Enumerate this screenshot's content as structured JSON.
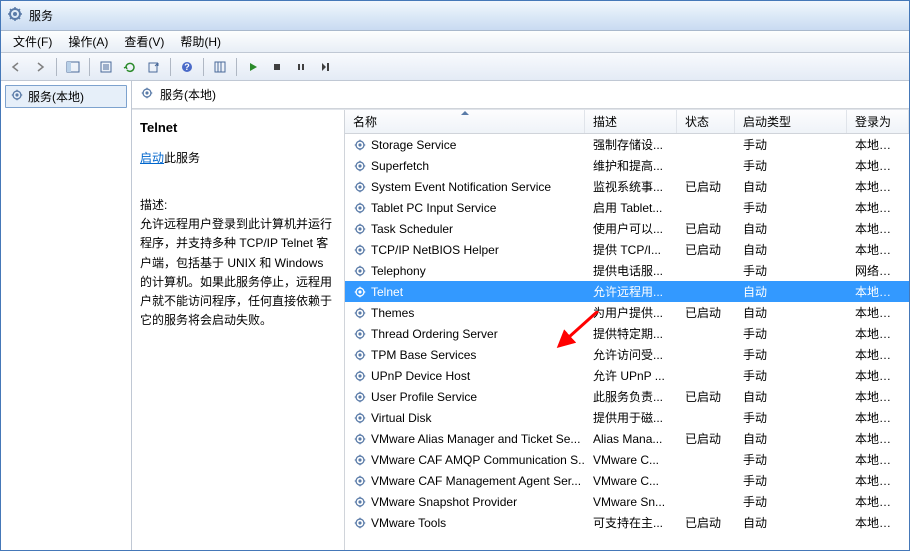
{
  "window": {
    "title": "服务"
  },
  "menu": {
    "file": "文件(F)",
    "action": "操作(A)",
    "view": "查看(V)",
    "help": "帮助(H)"
  },
  "tree": {
    "root": "服务(本地)"
  },
  "main_header": "服务(本地)",
  "detail": {
    "title": "Telnet",
    "link_start": "启动",
    "link_suffix": "此服务",
    "desc_label": "描述:",
    "desc_text": "允许远程用户登录到此计算机并运行程序，并支持多种 TCP/IP Telnet 客户端，包括基于 UNIX 和 Windows 的计算机。如果此服务停止，远程用户就不能访问程序，任何直接依赖于它的服务将会启动失败。"
  },
  "columns": {
    "name": "名称",
    "desc": "描述",
    "status": "状态",
    "startup": "启动类型",
    "logon": "登录为"
  },
  "services": [
    {
      "name": "Storage Service",
      "desc": "强制存储设...",
      "status": "",
      "startup": "手动",
      "logon": "本地系统"
    },
    {
      "name": "Superfetch",
      "desc": "维护和提高...",
      "status": "",
      "startup": "手动",
      "logon": "本地系统"
    },
    {
      "name": "System Event Notification Service",
      "desc": "监视系统事...",
      "status": "已启动",
      "startup": "自动",
      "logon": "本地系统"
    },
    {
      "name": "Tablet PC Input Service",
      "desc": "启用 Tablet...",
      "status": "",
      "startup": "手动",
      "logon": "本地系统"
    },
    {
      "name": "Task Scheduler",
      "desc": "使用户可以...",
      "status": "已启动",
      "startup": "自动",
      "logon": "本地系统"
    },
    {
      "name": "TCP/IP NetBIOS Helper",
      "desc": "提供 TCP/I...",
      "status": "已启动",
      "startup": "自动",
      "logon": "本地服务"
    },
    {
      "name": "Telephony",
      "desc": "提供电话服...",
      "status": "",
      "startup": "手动",
      "logon": "网络服务"
    },
    {
      "name": "Telnet",
      "desc": "允许远程用...",
      "status": "",
      "startup": "自动",
      "logon": "本地服务",
      "selected": true
    },
    {
      "name": "Themes",
      "desc": "为用户提供...",
      "status": "已启动",
      "startup": "自动",
      "logon": "本地系统"
    },
    {
      "name": "Thread Ordering Server",
      "desc": "提供特定期...",
      "status": "",
      "startup": "手动",
      "logon": "本地服务"
    },
    {
      "name": "TPM Base Services",
      "desc": "允许访问受...",
      "status": "",
      "startup": "手动",
      "logon": "本地服务"
    },
    {
      "name": "UPnP Device Host",
      "desc": "允许 UPnP ...",
      "status": "",
      "startup": "手动",
      "logon": "本地服务"
    },
    {
      "name": "User Profile Service",
      "desc": "此服务负责...",
      "status": "已启动",
      "startup": "自动",
      "logon": "本地系统"
    },
    {
      "name": "Virtual Disk",
      "desc": "提供用于磁...",
      "status": "",
      "startup": "手动",
      "logon": "本地系统"
    },
    {
      "name": "VMware Alias Manager and Ticket Se...",
      "desc": "Alias Mana...",
      "status": "已启动",
      "startup": "自动",
      "logon": "本地系统"
    },
    {
      "name": "VMware CAF AMQP Communication S...",
      "desc": "VMware C...",
      "status": "",
      "startup": "手动",
      "logon": "本地系统"
    },
    {
      "name": "VMware CAF Management Agent Ser...",
      "desc": "VMware C...",
      "status": "",
      "startup": "手动",
      "logon": "本地系统"
    },
    {
      "name": "VMware Snapshot Provider",
      "desc": "VMware Sn...",
      "status": "",
      "startup": "手动",
      "logon": "本地系统"
    },
    {
      "name": "VMware Tools",
      "desc": "可支持在主...",
      "status": "已启动",
      "startup": "自动",
      "logon": "本地系统"
    }
  ]
}
